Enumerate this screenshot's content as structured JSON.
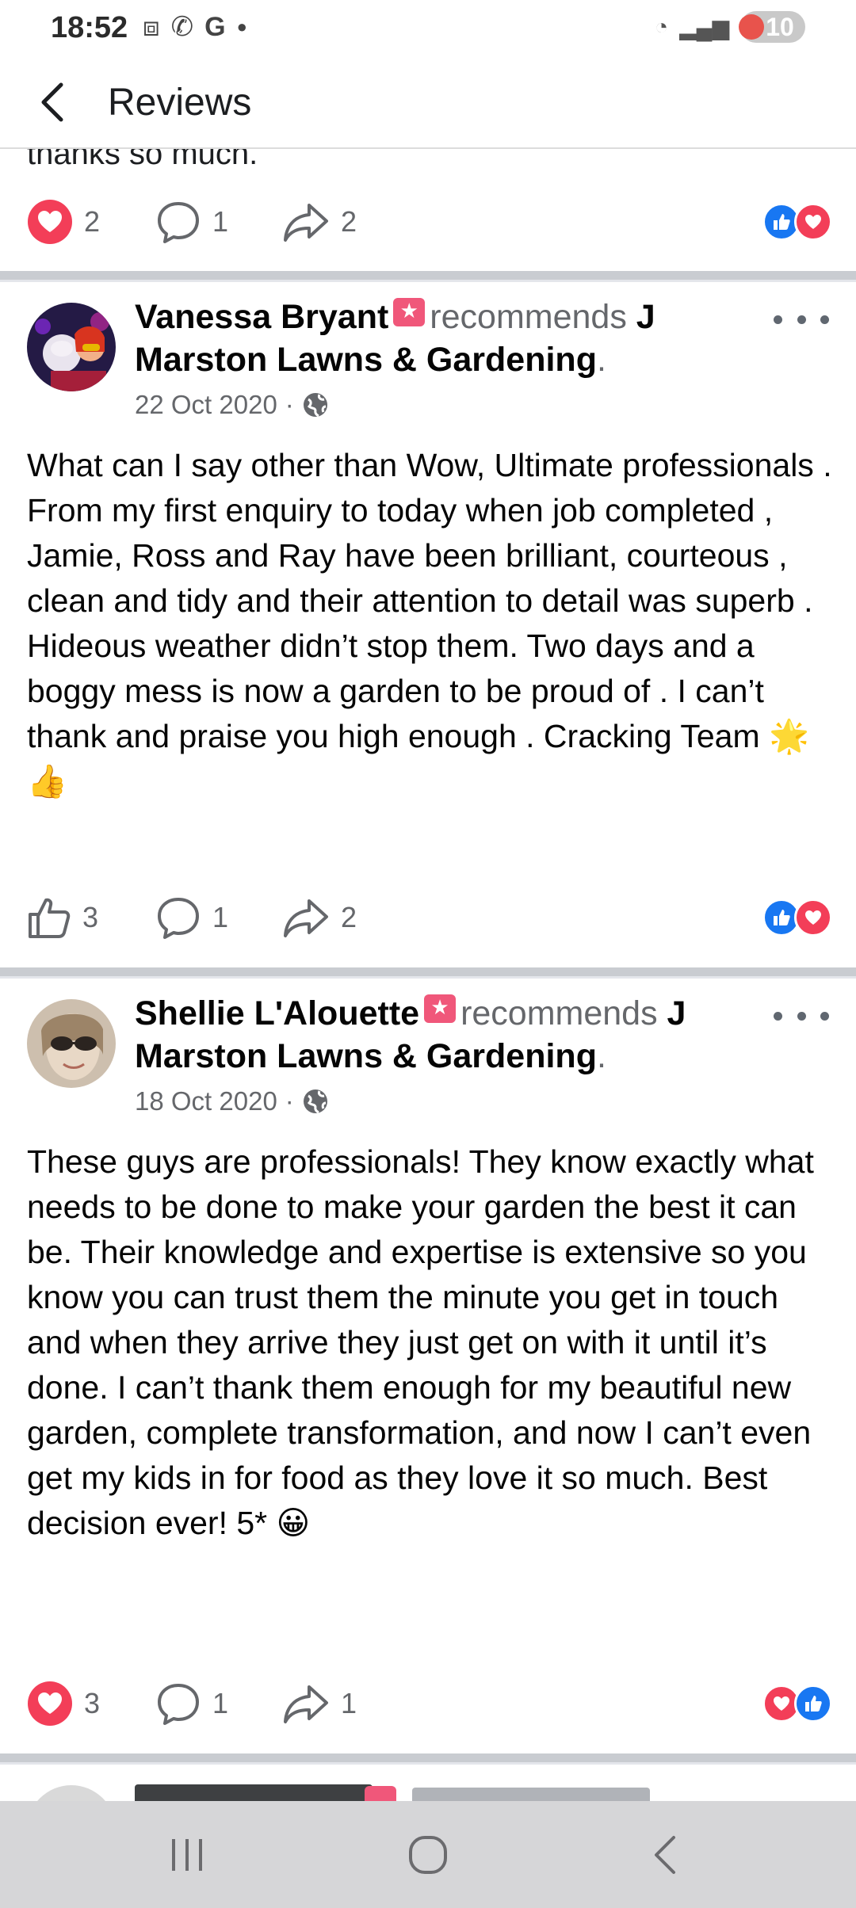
{
  "status_bar": {
    "time": "18:52",
    "battery": "10"
  },
  "header": {
    "title": "Reviews"
  },
  "previous_post": {
    "tail_text": "thanks so much.",
    "reaction_count": "2",
    "comment_count": "1",
    "share_count": "2"
  },
  "posts": [
    {
      "author": "Vanessa Bryant",
      "recommends": "recommends",
      "page_name": "J Marston Lawns & Gardening",
      "date": "22 Oct 2020",
      "body": "What can I say other than Wow, Ultimate professionals . From my first enquiry to today when job completed , Jamie, Ross and Ray have been brilliant, courteous , clean and tidy and their attention to detail was superb . Hideous weather didn’t stop them. Two days and a boggy mess is now a garden to be proud of . I can’t thank and praise you high enough . Cracking Team 🌟👍",
      "reaction_count": "3",
      "comment_count": "1",
      "share_count": "2"
    },
    {
      "author": "Shellie L'Alouette",
      "recommends": "recommends",
      "page_name": "J Marston Lawns & Gardening",
      "date": "18 Oct 2020",
      "body": "These guys are professionals! They know exactly what needs to be done to make your garden the best it can be. Their knowledge and expertise is extensive so you know you can trust them the minute you get in touch and when they arrive they just get on with it until it’s done.  I can’t thank them enough for my beautiful new garden, complete transformation, and now I can’t even get my kids in for food as they love it so much. Best decision ever! 5* 😀",
      "reaction_count": "3",
      "comment_count": "1",
      "share_count": "1"
    }
  ],
  "colors": {
    "like_blue": "#1877f2",
    "love_red": "#f33e58",
    "recommend_badge": "#f0577a",
    "muted_text": "#65676b"
  }
}
